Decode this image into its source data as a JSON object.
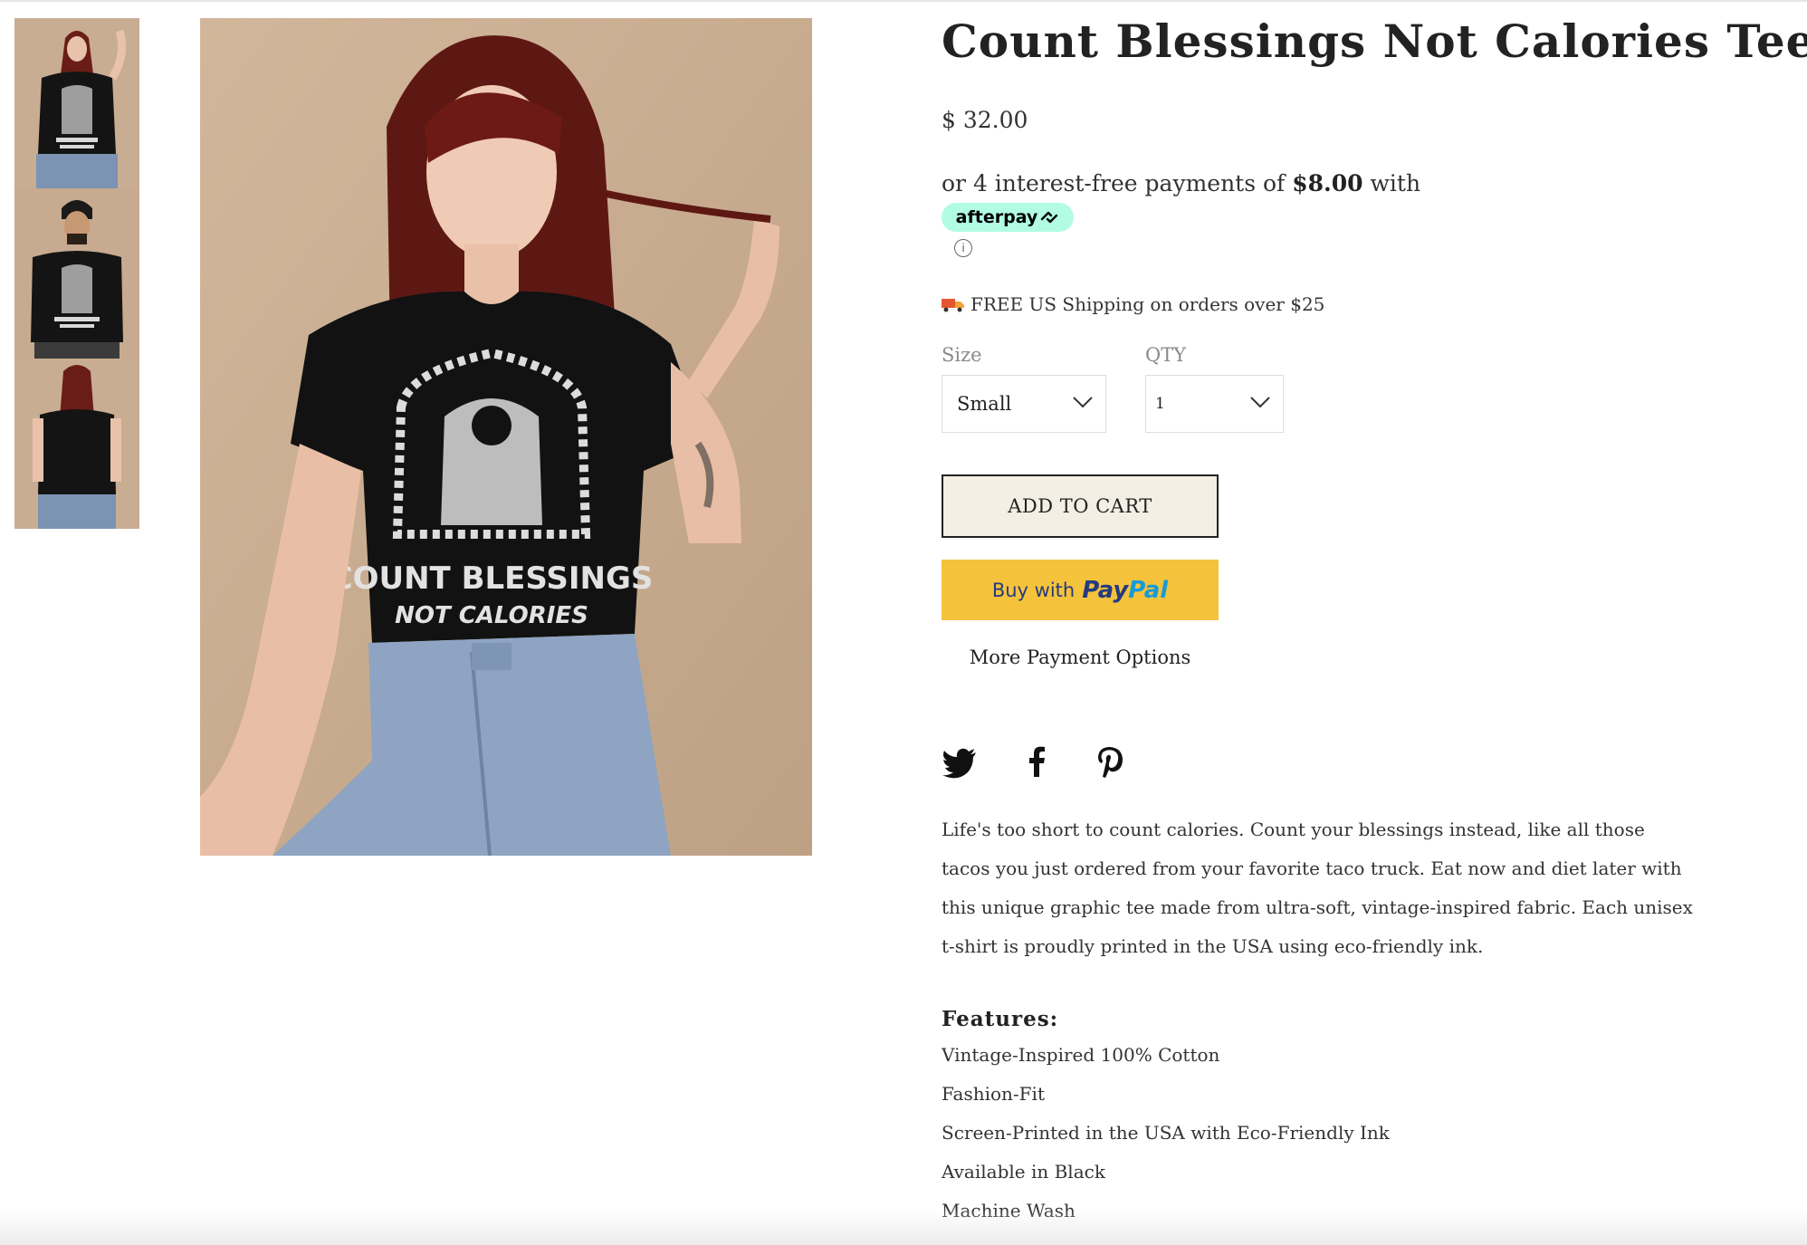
{
  "product": {
    "title": "Count Blessings Not Calories Tee",
    "price": "$ 32.00",
    "afterpay": {
      "prefix": "or 4 interest-free payments of ",
      "amount": "$8.00",
      "suffix": " with",
      "badge_label": "afterpay",
      "badge_color": "#b2fce4",
      "info_glyph": "i"
    },
    "shipping_text": "FREE US Shipping on orders over $25",
    "shipping_icon": "truck-icon",
    "shirt_print": {
      "line1": "COUNT BLESSINGS",
      "line2": "NOT CALORIES"
    }
  },
  "gallery": {
    "thumbnails": [
      "front-woman",
      "front-man",
      "back-woman"
    ],
    "main_image": "woman-front-pose"
  },
  "options": {
    "size_label": "Size",
    "size_value": "Small",
    "qty_label": "QTY",
    "qty_value": "1"
  },
  "actions": {
    "add_to_cart": "ADD TO CART",
    "paypal_prefix": "Buy with",
    "paypal_brand_1": "Pay",
    "paypal_brand_2": "Pal",
    "paypal_color": "#f5c33b",
    "more_payment": "More Payment Options"
  },
  "social": [
    "twitter-icon",
    "facebook-icon",
    "pinterest-icon"
  ],
  "description": "Life's too short to count calories. Count your blessings instead, like all those tacos you just ordered from your favorite taco truck. Eat now and diet later with this unique graphic tee made from ultra-soft, vintage-inspired fabric. Each unisex t-shirt is proudly printed in the USA using eco-friendly ink.",
  "features": {
    "title": "Features:",
    "items": [
      "Vintage-Inspired 100% Cotton",
      "Fashion-Fit",
      "Screen-Printed in the USA with Eco-Friendly Ink",
      "Available in Black",
      "Machine Wash"
    ]
  }
}
